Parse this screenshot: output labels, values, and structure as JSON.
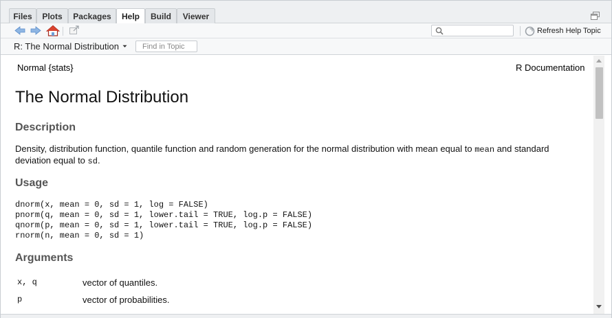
{
  "tabs": [
    {
      "label": "Files"
    },
    {
      "label": "Plots"
    },
    {
      "label": "Packages"
    },
    {
      "label": "Help",
      "active": true
    },
    {
      "label": "Build"
    },
    {
      "label": "Viewer"
    }
  ],
  "toolbar": {
    "icons": [
      "back-arrow-icon",
      "forward-arrow-icon",
      "home-icon",
      "popout-window-icon"
    ],
    "search_placeholder": "",
    "refresh_label": "Refresh Help Topic"
  },
  "topicbar": {
    "topic_label": "R: The Normal Distribution",
    "find_placeholder": "Find in Topic"
  },
  "doc": {
    "header_left": "Normal {stats}",
    "header_right": "R Documentation",
    "title": "The Normal Distribution",
    "description_heading": "Description",
    "description_parts": [
      "Density, distribution function, quantile function and random generation for the normal distribution with mean equal to ",
      "mean",
      " and standard deviation equal to ",
      "sd",
      "."
    ],
    "usage_heading": "Usage",
    "usage_lines": [
      "dnorm(x, mean = 0, sd = 1, log = FALSE)",
      "pnorm(q, mean = 0, sd = 1, lower.tail = TRUE, log.p = FALSE)",
      "qnorm(p, mean = 0, sd = 1, lower.tail = TRUE, log.p = FALSE)",
      "rnorm(n, mean = 0, sd = 1)"
    ],
    "arguments_heading": "Arguments",
    "arguments": [
      {
        "name": "x, q",
        "desc": "vector of quantiles."
      },
      {
        "name": "p",
        "desc": "vector of probabilities."
      }
    ]
  },
  "colors": {
    "accent_arrow": "#6e9fd6",
    "home_roof": "#c0392b",
    "heading_gray": "#555555"
  }
}
